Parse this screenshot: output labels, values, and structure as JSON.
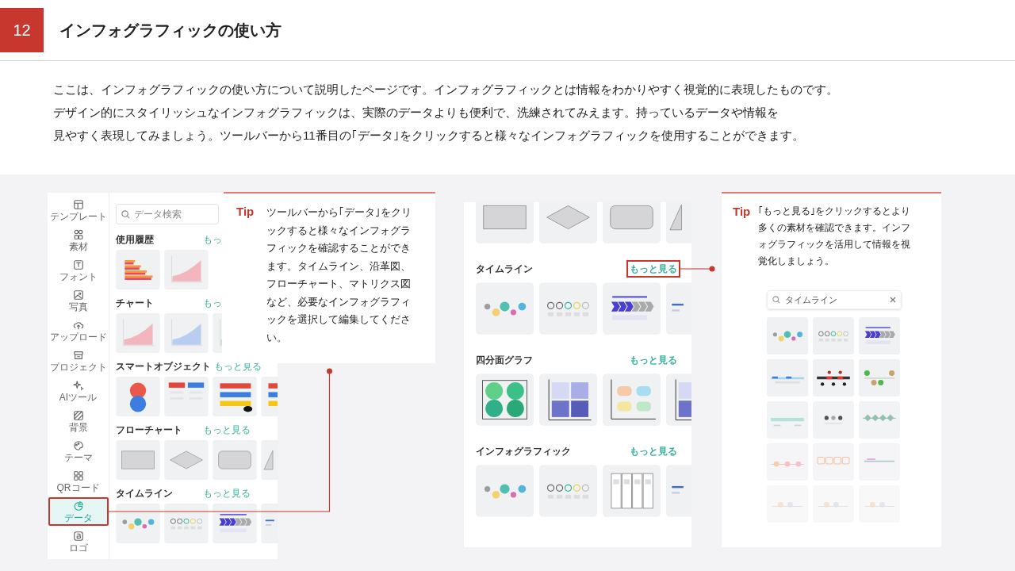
{
  "page": {
    "number": "12",
    "title": "インフォグラフィックの使い方"
  },
  "intro_lines": [
    "ここは、インフォグラフィックの使い方について説明したページです。インフォグラフィックとは情報をわかりやすく視覚的に表現したものです。",
    "デザイン的にスタイリッシュなインフォグラフィックは、実際のデータよりも便利で、洗練されてみえます。持っているデータや情報を",
    "見やすく表現してみましょう。ツールバーから11番目の｢データ｣をクリックすると様々なインフォグラフィックを使用することができます。"
  ],
  "app_panel": {
    "sidebar": {
      "items": [
        {
          "label": "テンプレート",
          "selected": false,
          "annotated": false
        },
        {
          "label": "素材",
          "selected": false,
          "annotated": false
        },
        {
          "label": "フォント",
          "selected": false,
          "annotated": false
        },
        {
          "label": "写真",
          "selected": false,
          "annotated": false
        },
        {
          "label": "アップロード",
          "selected": false,
          "annotated": false
        },
        {
          "label": "プロジェクト",
          "selected": false,
          "annotated": false
        },
        {
          "label": "AIツール",
          "selected": false,
          "annotated": false
        },
        {
          "label": "背景",
          "selected": false,
          "annotated": false
        },
        {
          "label": "テーマ",
          "selected": false,
          "annotated": false
        },
        {
          "label": "QRコード",
          "selected": false,
          "annotated": false
        },
        {
          "label": "データ",
          "selected": true,
          "annotated": true
        },
        {
          "label": "ロゴ",
          "selected": false,
          "annotated": false
        }
      ]
    },
    "search": {
      "placeholder": "データ検索"
    },
    "sections": [
      {
        "kind": "history",
        "title": "使用履歴",
        "more": "もっ"
      },
      {
        "kind": "chart",
        "title": "チャート",
        "more": "もっ"
      },
      {
        "kind": "smart",
        "title": "スマートオブジェクト",
        "more": "もっと見る"
      },
      {
        "kind": "flow",
        "title": "フローチャート",
        "more": "もっと見る"
      },
      {
        "kind": "timeline",
        "title": "タイムライン",
        "more": "もっと見る"
      }
    ]
  },
  "tip_1": {
    "label": "Tip",
    "text": "ツールバーから｢データ｣をクリックすると様々なインフォグラフィックを確認することができます。タイムライン、沿革図、フローチャート、マトリクス図など、必要なインフォグラフィックを選択して編集してください。"
  },
  "library_panel": {
    "sections": [
      {
        "kind": "flow"
      },
      {
        "kind": "timeline",
        "title": "タイムライン",
        "more": "もっと見る",
        "annotated": true
      },
      {
        "kind": "quadrant",
        "title": "四分面グラフ",
        "more": "もっと見る",
        "annotated": false
      },
      {
        "kind": "infographic",
        "title": "インフォグラフィック",
        "more": "もっと見る",
        "annotated": false
      }
    ]
  },
  "tip_2": {
    "label": "Tip",
    "text": "｢もっと見る｣をクリックするとより多くの素材を確認できます。インフォグラフィックを活用して情報を視覚化しましょう。",
    "search": {
      "value": "タイムライン"
    }
  }
}
